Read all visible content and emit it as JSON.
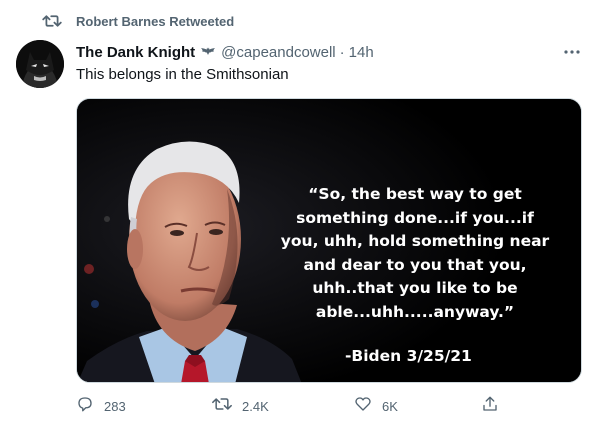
{
  "social_context": {
    "text": "Robert Barnes Retweeted",
    "icon": "retweet-icon"
  },
  "tweet": {
    "display_name": "The Dank Knight",
    "badge_icon": "bat-icon",
    "handle": "@capeandcowell",
    "separator": "·",
    "time": "14h",
    "text": "This belongs in the Smithsonian",
    "media": {
      "quote_lines": [
        "“So, the best way to get",
        "something done...if you...if",
        "you, uhh, hold something near",
        "and dear to you that you,",
        "uhh..that you like to be",
        "able...uhh.....anyway.”"
      ],
      "attribution": "-Biden 3/25/21"
    },
    "actions": {
      "reply_count": "283",
      "retweet_count": "2.4K",
      "like_count": "6K"
    }
  },
  "colors": {
    "secondary_text": "#536471",
    "primary_text": "#0f1419",
    "media_background": "#000000"
  }
}
